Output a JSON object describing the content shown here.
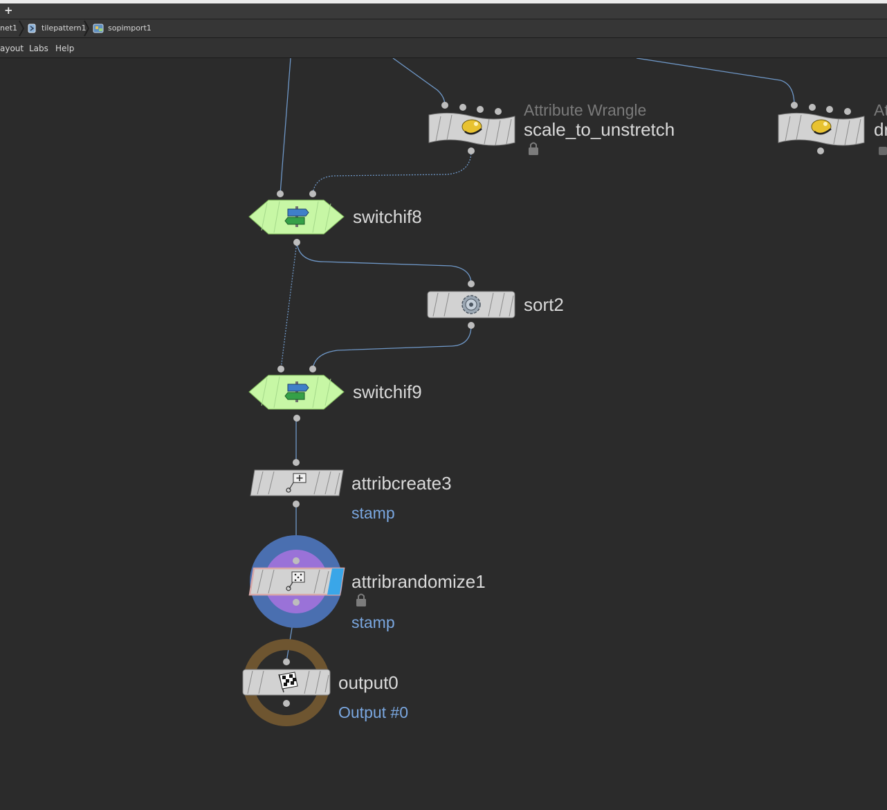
{
  "tabbar": {
    "add_tab": "+"
  },
  "breadcrumbs": [
    {
      "label": "net1",
      "icon": "network-icon"
    },
    {
      "label": "tilepattern1",
      "icon": "subnet-icon"
    },
    {
      "label": "sopimport1",
      "icon": "sop-import-icon"
    }
  ],
  "menu": {
    "layout": "ayout",
    "labs": "Labs",
    "help": "Help"
  },
  "nodes": {
    "wrangle1": {
      "type": "Attribute Wrangle",
      "name": "scale_to_unstretch",
      "icon": "wrangle-hat-icon",
      "locked": true
    },
    "wrangle2": {
      "type": "At",
      "name": "dr",
      "icon": "wrangle-hat-icon"
    },
    "switchif8": {
      "name": "switchif8",
      "icon": "switch-signpost-icon"
    },
    "sort2": {
      "name": "sort2",
      "icon": "gear-icon"
    },
    "switchif9": {
      "name": "switchif9",
      "icon": "switch-signpost-icon"
    },
    "attribcreate3": {
      "name": "attribcreate3",
      "comment": "stamp",
      "icon": "attrib-create-icon"
    },
    "attribrandomize1": {
      "name": "attribrandomize1",
      "comment": "stamp",
      "icon": "dice-icon",
      "locked": true
    },
    "output0": {
      "name": "output0",
      "comment": "Output #0",
      "icon": "checkered-flag-icon"
    }
  },
  "colors": {
    "background": "#2b2b2b",
    "wire": "#6f98c8",
    "node_gray": "#d2d2d2",
    "switch_green": "#c7f7a5",
    "comment_blue": "#7aa7e0",
    "display_flag": "#3aa6e8",
    "template_purple": "#9a72d8",
    "render_blue": "#4a6fb0",
    "output_ring": "#6e5530"
  }
}
